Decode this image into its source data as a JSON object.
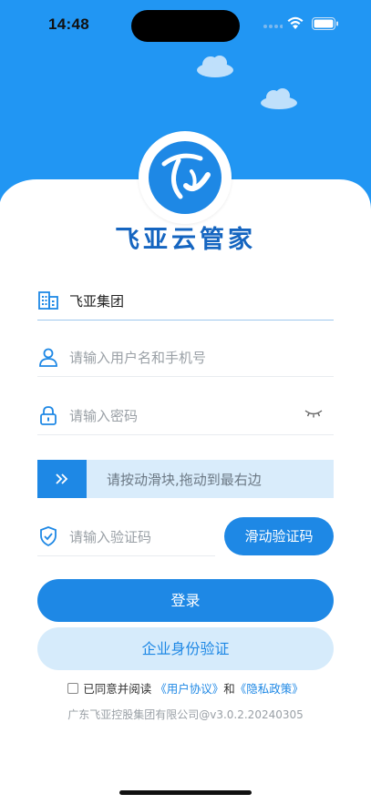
{
  "status_bar": {
    "time": "14:48"
  },
  "brand": {
    "name": "飞亚云管家"
  },
  "form": {
    "company": {
      "value": "飞亚集团"
    },
    "username": {
      "placeholder": "请输入用户名和手机号"
    },
    "password": {
      "placeholder": "请输入密码"
    },
    "slider": {
      "hint": "请按动滑块,拖动到最右边"
    },
    "captcha": {
      "placeholder": "请输入验证码",
      "button": "滑动验证码"
    }
  },
  "actions": {
    "login": "登录",
    "enterprise_auth": "企业身份验证"
  },
  "agreement": {
    "prefix": "已同意并阅读",
    "user_agreement": "《用户协议》",
    "and": "和",
    "privacy_policy": "《隐私政策》"
  },
  "footer": {
    "copyright": "广东飞亚控股集团有限公司@v3.0.2.20240305"
  },
  "colors": {
    "primary": "#1e88e5",
    "hero": "#2196f3",
    "brand_text": "#1565c0",
    "light": "#d6ebfb"
  }
}
